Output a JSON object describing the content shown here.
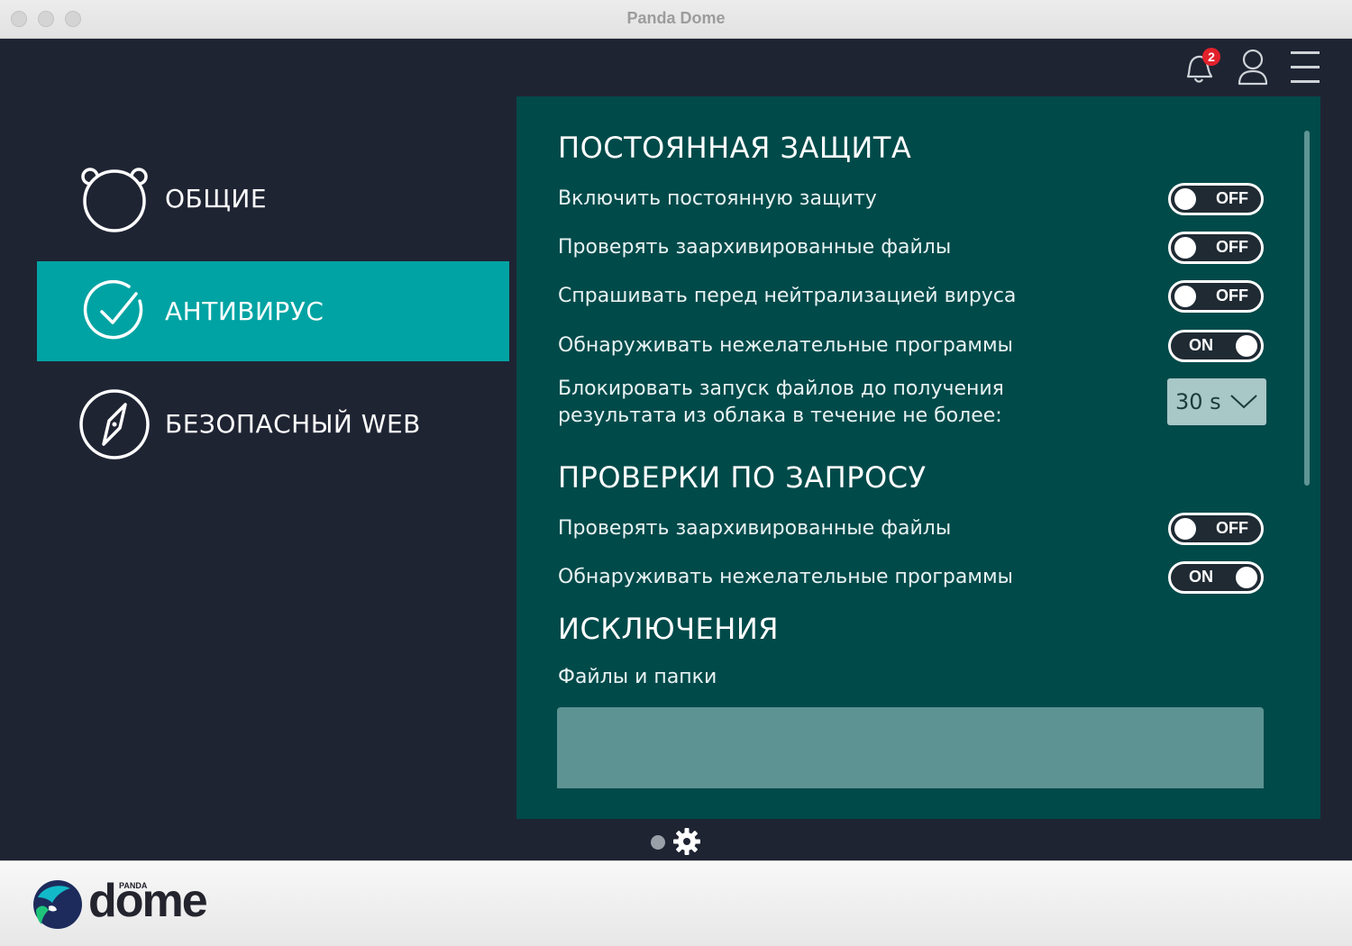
{
  "window": {
    "title": "Panda Dome"
  },
  "header": {
    "notifications_count": "2",
    "bell_icon": "bell-icon",
    "user_icon": "user-icon",
    "menu_icon": "hamburger-menu-icon"
  },
  "sidebar": {
    "items": [
      {
        "label": "ОБЩИЕ",
        "icon": "panda-head-icon",
        "active": false
      },
      {
        "label": "АНТИВИРУС",
        "icon": "check-circle-icon",
        "active": true
      },
      {
        "label": "БЕЗОПАСНЫЙ WEB",
        "icon": "compass-icon",
        "active": false
      }
    ]
  },
  "settings": {
    "resident": {
      "title": "ПОСТОЯННАЯ ЗАЩИТА",
      "rows": [
        {
          "label": "Включить постоянную защиту",
          "state": "OFF"
        },
        {
          "label": "Проверять заархивированные файлы",
          "state": "OFF"
        },
        {
          "label": "Спрашивать перед нейтрализацией вируса",
          "state": "OFF"
        },
        {
          "label": "Обнаруживать нежелательные программы",
          "state": "ON"
        }
      ],
      "block_label_line1": "Блокировать запуск файлов до получения",
      "block_label_line2": "результата из облака в течение не более:",
      "block_value": "30 s"
    },
    "ondemand": {
      "title": "ПРОВЕРКИ ПО ЗАПРОСУ",
      "rows": [
        {
          "label": "Проверять заархивированные файлы",
          "state": "OFF"
        },
        {
          "label": "Обнаруживать нежелательные программы",
          "state": "ON"
        }
      ]
    },
    "exclusions": {
      "title": "ИСКЛЮЧЕНИЯ",
      "files_label": "Файлы и папки"
    }
  },
  "footer": {
    "logo_small": "PANDA",
    "logo_word": "dome"
  },
  "colors": {
    "background": "#1f2433",
    "accent": "#00a3a3",
    "panel": "#004a4a",
    "badge": "#e2222b"
  }
}
